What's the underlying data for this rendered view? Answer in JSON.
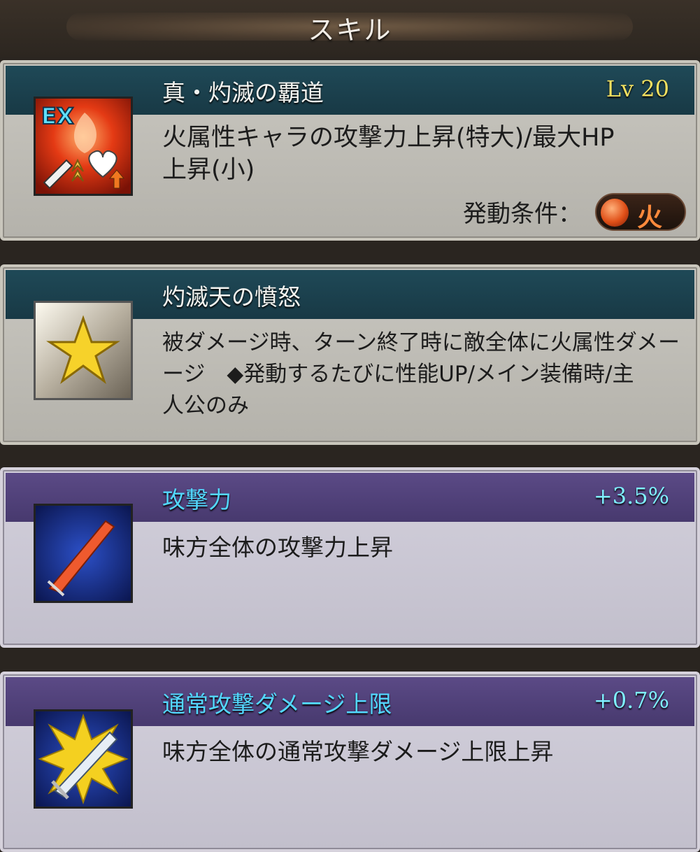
{
  "header": {
    "title": "スキル"
  },
  "skills": [
    {
      "title": "真・灼滅の覇道",
      "level": "Lv 20",
      "desc1": "火属性キャラの攻撃力上昇(特大)/最大HP",
      "desc2": "上昇(小)",
      "cond_label": "発動条件：",
      "cond_value": "火",
      "icon": "ex-attack-hp-up-icon",
      "badge": "EX"
    },
    {
      "title": "灼滅天の憤怒",
      "desc1": "被ダメージ時、ターン終了時に敵全体に火属性ダメー",
      "desc2": "ージ　◆発動するたびに性能UP/メイン装備時/主",
      "desc3": "人公のみ",
      "icon": "star-icon"
    },
    {
      "title": "攻撃力",
      "value": "+3.5%",
      "desc1": "味方全体の攻撃力上昇",
      "icon": "sword-icon"
    },
    {
      "title": "通常攻撃ダメージ上限",
      "value": "+0.7%",
      "desc1": "味方全体の通常攻撃ダメージ上限上昇",
      "icon": "sword-burst-icon"
    }
  ],
  "colors": {
    "teal_band": "#1f4957",
    "purple_band": "#5b4a86",
    "level_gold": "#f2e060",
    "bonus_cyan": "#7ff0ff",
    "title_cyan": "#53d8ff"
  }
}
